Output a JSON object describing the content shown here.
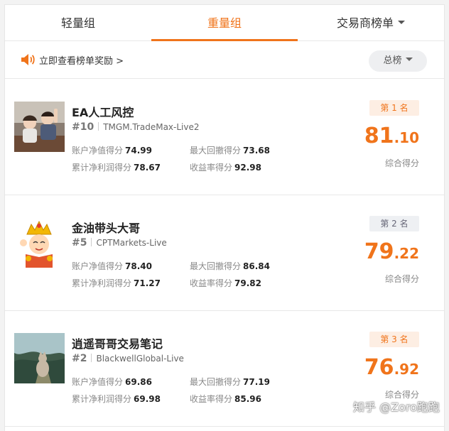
{
  "tabs": [
    "轻量组",
    "重量组",
    "交易商榜单"
  ],
  "notice": "立即查看榜单奖励 >",
  "filter": "总榜",
  "stat_labels": {
    "net_value": "账户净值得分",
    "max_drawdown": "最大回撤得分",
    "net_profit": "累计净利润得分",
    "return_rate": "收益率得分"
  },
  "score_label": "综合得分",
  "entries": [
    {
      "badge": "第 1 名",
      "name": "EA人工风控",
      "rank": "#10",
      "account": "TMGM.TradeMax-Live2",
      "net_value": "74.99",
      "max_drawdown": "73.68",
      "net_profit": "78.67",
      "return_rate": "92.98",
      "score_int": "81",
      "score_dec": ".10",
      "avatar": "photo-children"
    },
    {
      "badge": "第 2 名",
      "name": "金油带头大哥",
      "rank": "#5",
      "account": "CPTMarkets-Live",
      "net_value": "78.40",
      "max_drawdown": "86.84",
      "net_profit": "71.27",
      "return_rate": "79.82",
      "score_int": "79",
      "score_dec": ".22",
      "avatar": "cartoon-monk"
    },
    {
      "badge": "第 3 名",
      "name": "逍遥哥哥交易笔记",
      "rank": "#2",
      "account": "BlackwellGlobal-Live",
      "net_value": "69.86",
      "max_drawdown": "77.19",
      "net_profit": "69.98",
      "return_rate": "85.96",
      "score_int": "76",
      "score_dec": ".92",
      "avatar": "photo-cat"
    }
  ],
  "watermark": "知乎 @Zoro跑跑",
  "colors": {
    "accent": "#f0741b",
    "badge_top_bg": "#fdeee3",
    "badge_norm_bg": "#eef0f3"
  }
}
